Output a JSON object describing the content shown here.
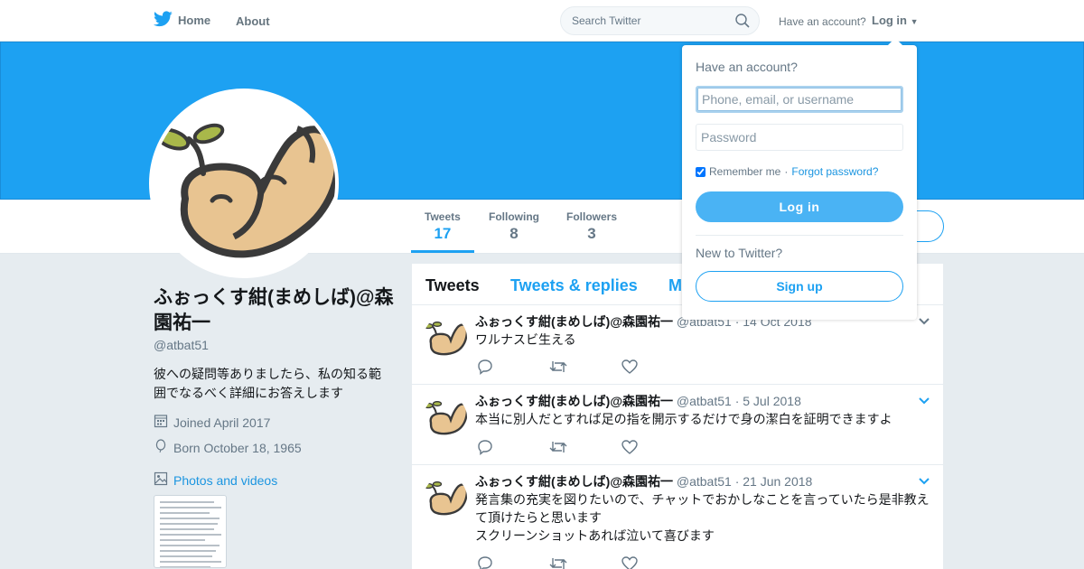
{
  "nav": {
    "home_label": "Home",
    "about_label": "About",
    "search_placeholder": "Search Twitter",
    "have_account": "Have an account?",
    "login_label": "Log in"
  },
  "profile": {
    "name": "ふぉっくす紺(まめしば)@森園祐一",
    "handle": "@atbat51",
    "bio": "彼への疑問等ありましたら、私の知る範囲でなるべく詳細にお答えします",
    "joined": "Joined April 2017",
    "born": "Born October 18, 1965",
    "photos_label": "Photos and videos"
  },
  "stats": [
    {
      "label": "Tweets",
      "value": "17"
    },
    {
      "label": "Following",
      "value": "8"
    },
    {
      "label": "Followers",
      "value": "3"
    }
  ],
  "tabs": [
    "Tweets",
    "Tweets & replies",
    "M"
  ],
  "tweets": [
    {
      "name": "ふぉっくす紺(まめしば)@森園祐一",
      "handle": "@atbat51",
      "date": "14 Oct 2018",
      "text": "ワルナスビ生える"
    },
    {
      "name": "ふぉっくす紺(まめしば)@森園祐一",
      "handle": "@atbat51",
      "date": "5 Jul 2018",
      "text": "本当に別人だとすれば足の指を開示するだけで身の潔白を証明できますよ"
    },
    {
      "name": "ふぉっくす紺(まめしば)@森園祐一",
      "handle": "@atbat51",
      "date": "21 Jun 2018",
      "text_lines": [
        "発言集の充実を図りたいので、チャットでおかしなことを言っていたら是非教えて頂けたらと思います",
        "スクリーンショットあれば泣いて喜びます"
      ]
    }
  ],
  "login": {
    "title": "Have an account?",
    "username_placeholder": "Phone, email, or username",
    "password_placeholder": "Password",
    "remember": "Remember me",
    "separator": "·",
    "forgot": "Forgot password?",
    "login_button": "Log in",
    "new_label": "New to Twitter?",
    "signup_button": "Sign up"
  },
  "colors": {
    "brand": "#1da1f2",
    "banner": "#1da1f2"
  }
}
